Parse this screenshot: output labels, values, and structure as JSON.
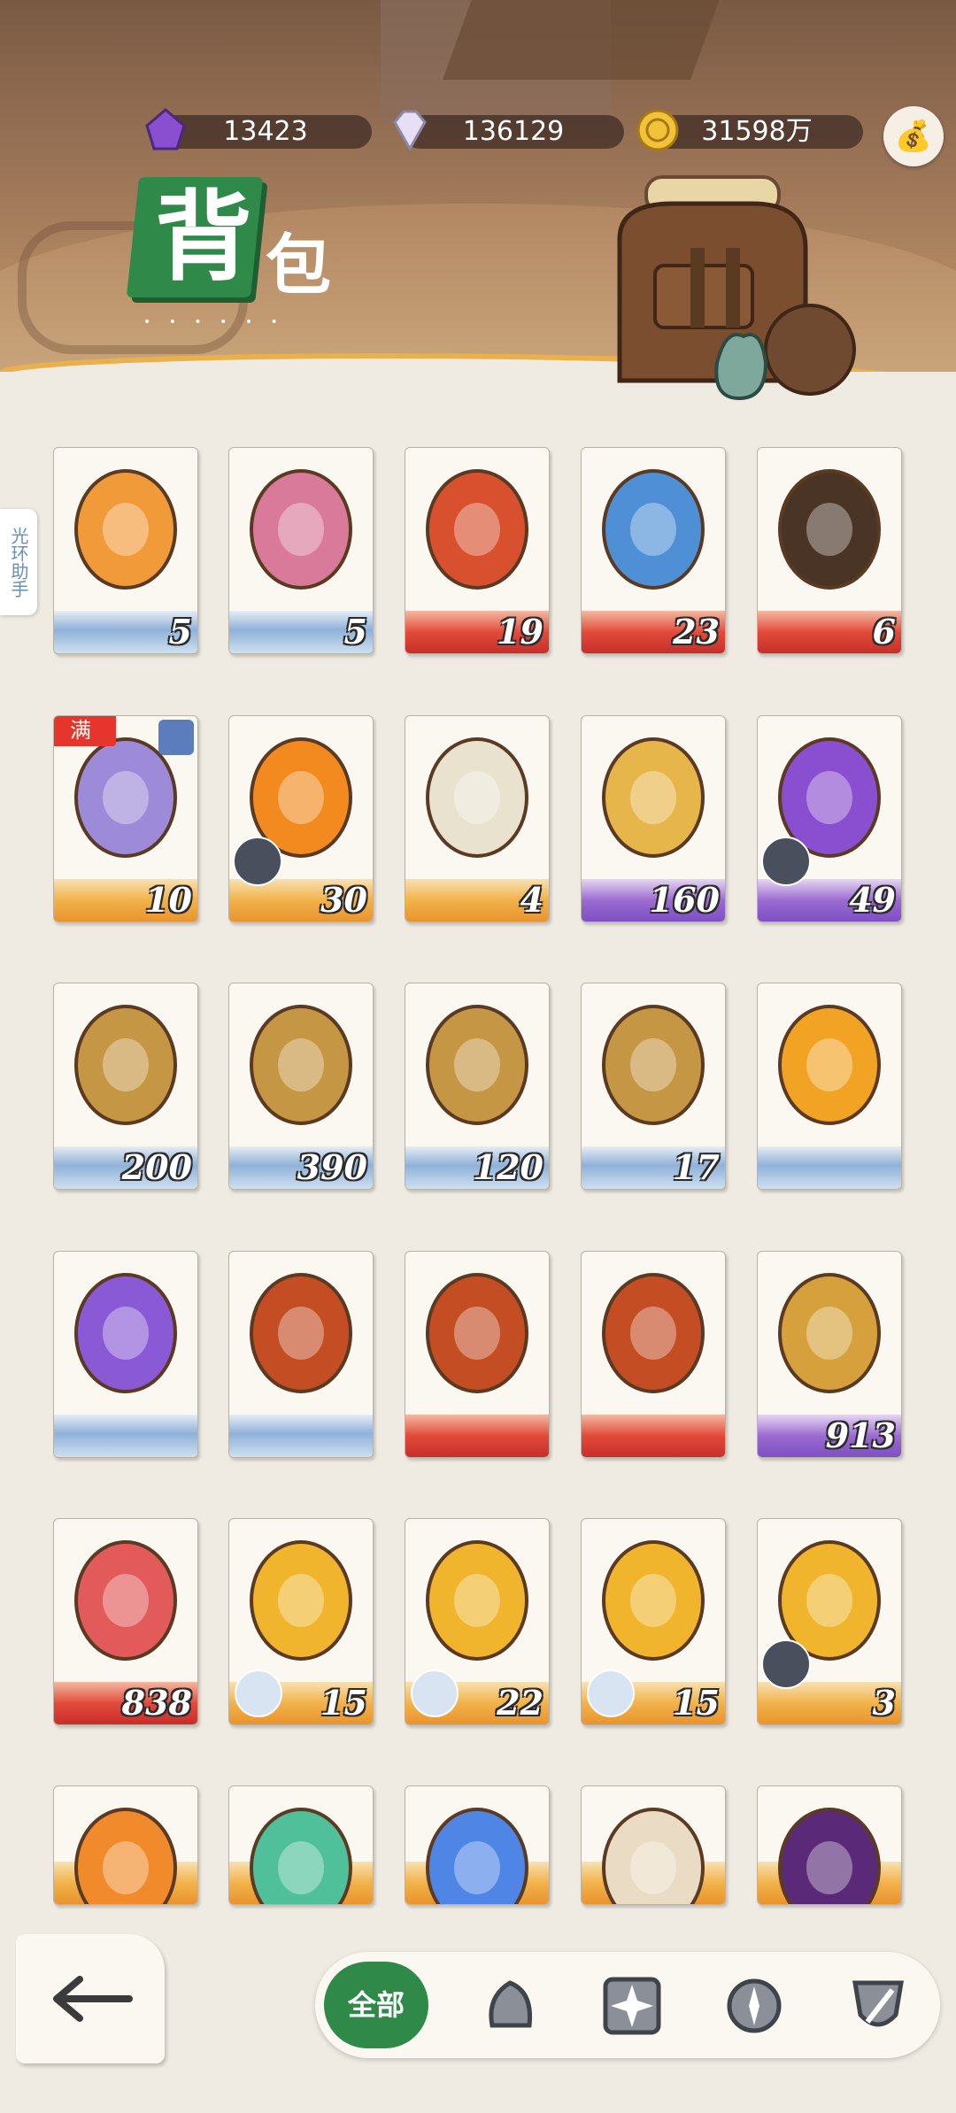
{
  "currencies": [
    {
      "name": "purple-crystal",
      "value": "13423"
    },
    {
      "name": "diamond",
      "value": "136129"
    },
    {
      "name": "gold-coin",
      "value": "31598万"
    }
  ],
  "title": {
    "main": "背",
    "sub": "包",
    "dots": "• • • • • •"
  },
  "side_tab": {
    "label": "光环助手"
  },
  "items": [
    {
      "art": "orange-ticket",
      "qty": "5",
      "rarity": "blue"
    },
    {
      "art": "pink-ticket",
      "qty": "5",
      "rarity": "blue"
    },
    {
      "art": "red-envelope",
      "qty": "19",
      "rarity": "red"
    },
    {
      "art": "crystal-orb",
      "qty": "23",
      "rarity": "red"
    },
    {
      "art": "black-envelope",
      "qty": "6",
      "rarity": "red"
    },
    {
      "art": "portrait-card",
      "qty": "10",
      "rarity": "orange",
      "badge": "满",
      "corner": "snowflake"
    },
    {
      "art": "fire-orb",
      "qty": "30",
      "rarity": "orange",
      "puzzle": true
    },
    {
      "art": "white-envelope",
      "qty": "4",
      "rarity": "orange"
    },
    {
      "art": "music-token",
      "qty": "160",
      "rarity": "purple"
    },
    {
      "art": "purple-orb",
      "qty": "49",
      "rarity": "purple",
      "puzzle": true
    },
    {
      "art": "acorn-green",
      "qty": "200",
      "rarity": "blue"
    },
    {
      "art": "acorn-red",
      "qty": "390",
      "rarity": "blue"
    },
    {
      "art": "acorn-leaf",
      "qty": "120",
      "rarity": "blue"
    },
    {
      "art": "acorn-star",
      "qty": "17",
      "rarity": "blue"
    },
    {
      "art": "gold-card",
      "qty": "",
      "rarity": "blue"
    },
    {
      "art": "purple-card",
      "qty": "",
      "rarity": "blue"
    },
    {
      "art": "chest",
      "qty": "",
      "rarity": "blue"
    },
    {
      "art": "chest",
      "qty": "",
      "rarity": "red"
    },
    {
      "art": "chest",
      "qty": "",
      "rarity": "red"
    },
    {
      "art": "acorn-gold",
      "qty": "913",
      "rarity": "purple"
    },
    {
      "art": "red-gem",
      "qty": "838",
      "rarity": "red"
    },
    {
      "art": "gold-gem",
      "qty": "15",
      "rarity": "orange",
      "avatar": true
    },
    {
      "art": "gold-gem",
      "qty": "22",
      "rarity": "orange",
      "avatar": true
    },
    {
      "art": "gold-gem",
      "qty": "15",
      "rarity": "orange",
      "avatar": true
    },
    {
      "art": "gold-gem",
      "qty": "3",
      "rarity": "orange",
      "puzzle": true
    },
    {
      "art": "orange-gem",
      "qty": "",
      "rarity": "orange"
    },
    {
      "art": "green-gem",
      "qty": "",
      "rarity": "orange"
    },
    {
      "art": "blue-gem",
      "qty": "",
      "rarity": "orange"
    },
    {
      "art": "hamster",
      "qty": "",
      "rarity": "orange"
    },
    {
      "art": "dark-crystal",
      "qty": "",
      "rarity": "orange"
    }
  ],
  "tabs": {
    "all_label": "全部",
    "icons": [
      "helmet-icon",
      "star-compass-icon",
      "compass-icon",
      "shield-sword-icon"
    ]
  }
}
